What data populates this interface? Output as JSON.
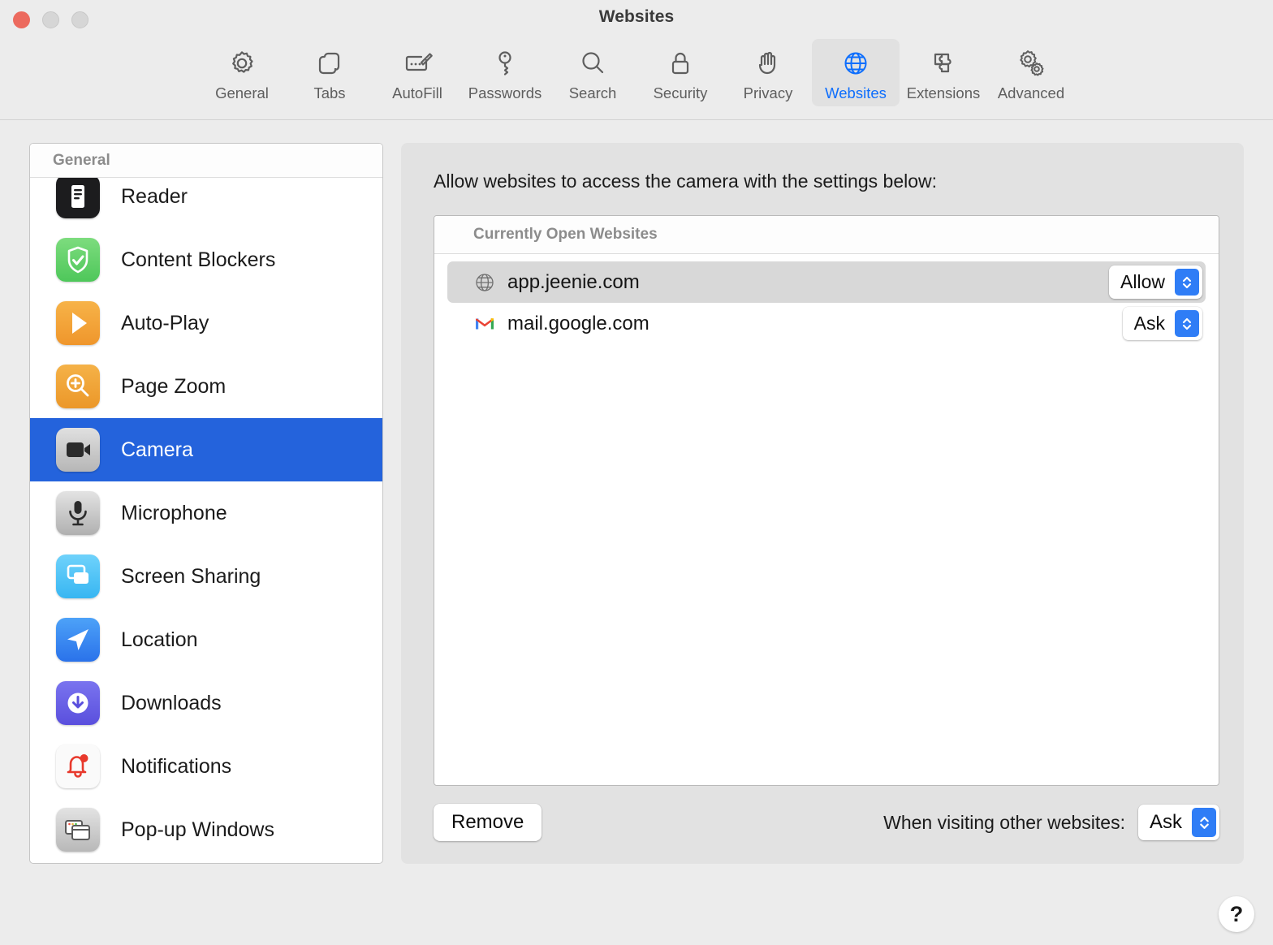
{
  "window": {
    "title": "Websites",
    "traffic_lights": [
      "close",
      "minimize",
      "zoom"
    ]
  },
  "toolbar": {
    "items": [
      {
        "label": "General",
        "icon": "gear-icon",
        "selected": false
      },
      {
        "label": "Tabs",
        "icon": "tabs-icon",
        "selected": false
      },
      {
        "label": "AutoFill",
        "icon": "autofill-icon",
        "selected": false
      },
      {
        "label": "Passwords",
        "icon": "key-icon",
        "selected": false
      },
      {
        "label": "Search",
        "icon": "search-icon",
        "selected": false
      },
      {
        "label": "Security",
        "icon": "lock-icon",
        "selected": false
      },
      {
        "label": "Privacy",
        "icon": "hand-icon",
        "selected": false
      },
      {
        "label": "Websites",
        "icon": "globe-icon",
        "selected": true
      },
      {
        "label": "Extensions",
        "icon": "puzzle-icon",
        "selected": false
      },
      {
        "label": "Advanced",
        "icon": "gears-icon",
        "selected": false
      }
    ],
    "selected_label": "Websites",
    "selected_color": "#0d6efd"
  },
  "sidebar": {
    "header": "General",
    "selected_item": "Camera",
    "selection_color": "#2463dc",
    "items": [
      {
        "label": "Reader",
        "icon": "reader-icon",
        "selected": false
      },
      {
        "label": "Content Blockers",
        "icon": "shield-check-icon",
        "selected": false
      },
      {
        "label": "Auto-Play",
        "icon": "play-icon",
        "selected": false
      },
      {
        "label": "Page Zoom",
        "icon": "magnifier-plus-icon",
        "selected": false
      },
      {
        "label": "Camera",
        "icon": "camera-icon",
        "selected": true
      },
      {
        "label": "Microphone",
        "icon": "microphone-icon",
        "selected": false
      },
      {
        "label": "Screen Sharing",
        "icon": "screen-sharing-icon",
        "selected": false
      },
      {
        "label": "Location",
        "icon": "location-arrow-icon",
        "selected": false
      },
      {
        "label": "Downloads",
        "icon": "download-icon",
        "selected": false
      },
      {
        "label": "Notifications",
        "icon": "bell-icon",
        "selected": false
      },
      {
        "label": "Pop-up Windows",
        "icon": "popup-windows-icon",
        "selected": false
      }
    ]
  },
  "content": {
    "description": "Allow websites to access the camera with the settings below:",
    "list_header": "Currently Open Websites",
    "rows": [
      {
        "site": "app.jeenie.com",
        "favicon": "globe-favicon-icon",
        "permission": "Allow",
        "selected": true
      },
      {
        "site": "mail.google.com",
        "favicon": "gmail-favicon-icon",
        "permission": "Ask",
        "selected": false
      }
    ],
    "remove_label": "Remove",
    "visiting_label": "When visiting other websites:",
    "visiting_value": "Ask",
    "help_label": "?"
  }
}
